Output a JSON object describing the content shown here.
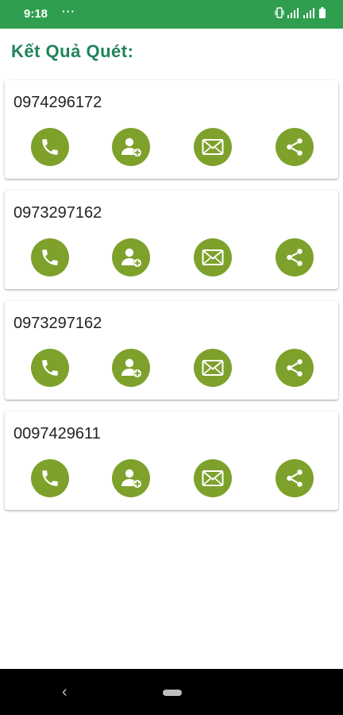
{
  "status_bar": {
    "time": "9:18",
    "notification_dots": "···"
  },
  "title": "Kết Quả Quét:",
  "results": [
    {
      "number": "0974296172"
    },
    {
      "number": "0973297162"
    },
    {
      "number": "0973297162"
    },
    {
      "number": "0097429611"
    }
  ],
  "actions": [
    {
      "name": "call",
      "icon": "phone-icon"
    },
    {
      "name": "add-contact",
      "icon": "add-contact-icon"
    },
    {
      "name": "message",
      "icon": "mail-icon"
    },
    {
      "name": "share",
      "icon": "share-icon"
    }
  ],
  "colors": {
    "status_bar": "#2f9e4f",
    "title": "#20845b",
    "action_button": "#7da12b"
  }
}
